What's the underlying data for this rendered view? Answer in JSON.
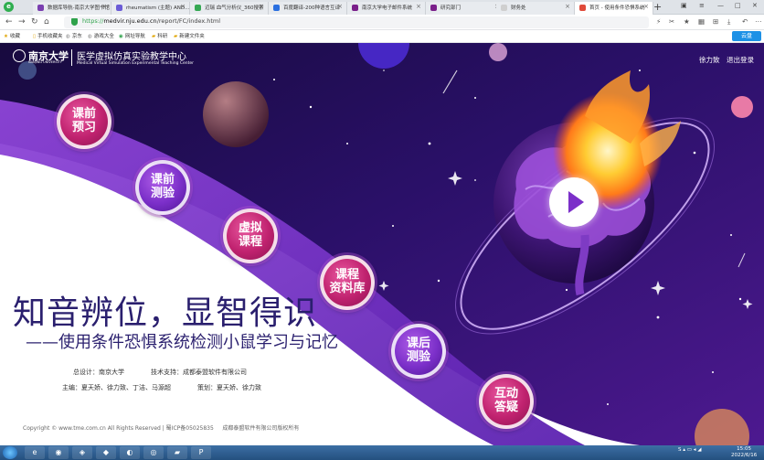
{
  "browser": {
    "tabs": [
      {
        "title": "数据库导航-南京大学图书馆",
        "active": false,
        "color": "#7a3fb0"
      },
      {
        "title": "rheumatism (主题) AND...",
        "active": false,
        "color": "#6b5cd6"
      },
      {
        "title": "迈瑞 血气分析仪_360搜索",
        "active": false,
        "color": "#35a853"
      },
      {
        "title": "百度翻译-200种语言互译",
        "active": false,
        "color": "#2a6fe0"
      },
      {
        "title": "南京大学电子邮件系统",
        "active": false,
        "color": "#7a1f8a"
      },
      {
        "title": "研究部门",
        "active": false,
        "color": "#7a1f8a"
      },
      {
        "title": "财务处",
        "active": false,
        "color": "#e6e6e6"
      },
      {
        "title": "首页 - 使用条件恐惧系统",
        "active": true,
        "color": "#e04a3a"
      }
    ],
    "new_tab": "+",
    "url_scheme": "https://",
    "url_host": "medvir.nju.edu.cn",
    "url_path": "/report/FC/index.html",
    "bookmarks": [
      "收藏",
      "手机收藏夹",
      "京东",
      "游戏大全",
      "网址导航",
      "科研",
      "新建文件夹"
    ],
    "ext_button": "云盘"
  },
  "site": {
    "university_name": "南京大学",
    "university_en": "NANJING UNIVERSITY",
    "center_name": "医学虚拟仿真实验教学中心",
    "center_en": "Medical Virtual Simulation Experimental Teaching Center",
    "user_name": "徐力致",
    "logout": "退出登录"
  },
  "menu": [
    {
      "label": "课前预习",
      "line1": "课前",
      "line2": "预习",
      "style": "pink"
    },
    {
      "label": "课前测验",
      "line1": "课前",
      "line2": "测验",
      "style": "purple"
    },
    {
      "label": "虚拟课程",
      "line1": "虚拟",
      "line2": "课程",
      "style": "pink"
    },
    {
      "label": "课程资料库",
      "line1": "课程",
      "line2": "资料库",
      "style": "pink"
    },
    {
      "label": "课后测验",
      "line1": "课后",
      "line2": "测验",
      "style": "purple"
    },
    {
      "label": "互动答疑",
      "line1": "互动",
      "line2": "答疑",
      "style": "pink"
    }
  ],
  "hero": {
    "title": "知音辨位，显智得识",
    "subtitle": "——使用条件恐惧系统检测小鼠学习与记忆"
  },
  "credits": {
    "design": "总设计：南京大学",
    "tech": "技术支持：成都泰盟软件有限公司",
    "editors": "主编：夏天娇、徐力致、丁洁、马源超",
    "planning": "策划：夏天娇、徐力致"
  },
  "footer": {
    "copyright": "Copyright © www.tme.com.cn All Rights Reserved | 蜀ICP备05025835",
    "company": "成都泰盟软件有限公司版权所有"
  },
  "taskbar": {
    "clock_time": "15:05",
    "clock_date": "2022/6/16"
  },
  "colors": {
    "space_dark": "#1b0b4a",
    "space_purple": "#4a1a8c",
    "band_purple": "#6a2ab8",
    "accent_pink": "#c0226f",
    "title_navy": "#2a1f6e"
  }
}
